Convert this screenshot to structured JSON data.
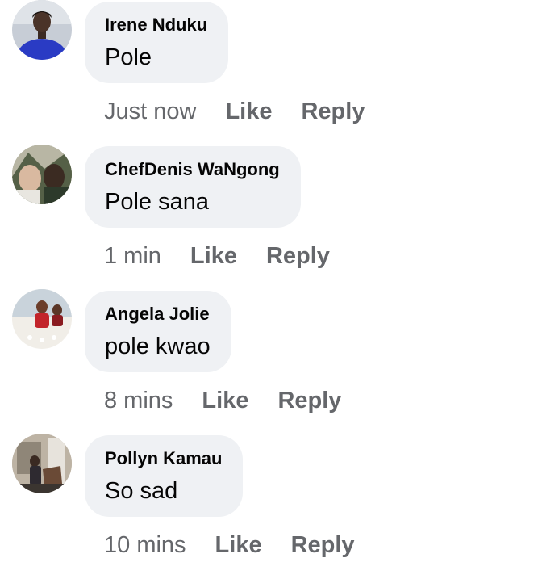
{
  "comments": [
    {
      "author": "Irene Nduku",
      "text": "Pole",
      "time": "Just now",
      "like": "Like",
      "reply": "Reply"
    },
    {
      "author": "ChefDenis WaNgong",
      "text": "Pole sana",
      "time": "1 min",
      "like": "Like",
      "reply": "Reply"
    },
    {
      "author": "Angela Jolie",
      "text": "pole kwao",
      "time": "8 mins",
      "like": "Like",
      "reply": "Reply"
    },
    {
      "author": "Pollyn Kamau",
      "text": "So sad",
      "time": "10 mins",
      "like": "Like",
      "reply": "Reply"
    }
  ],
  "colors": {
    "bubble": "#eff1f4",
    "meta_text": "#65676b",
    "text": "#050505"
  }
}
